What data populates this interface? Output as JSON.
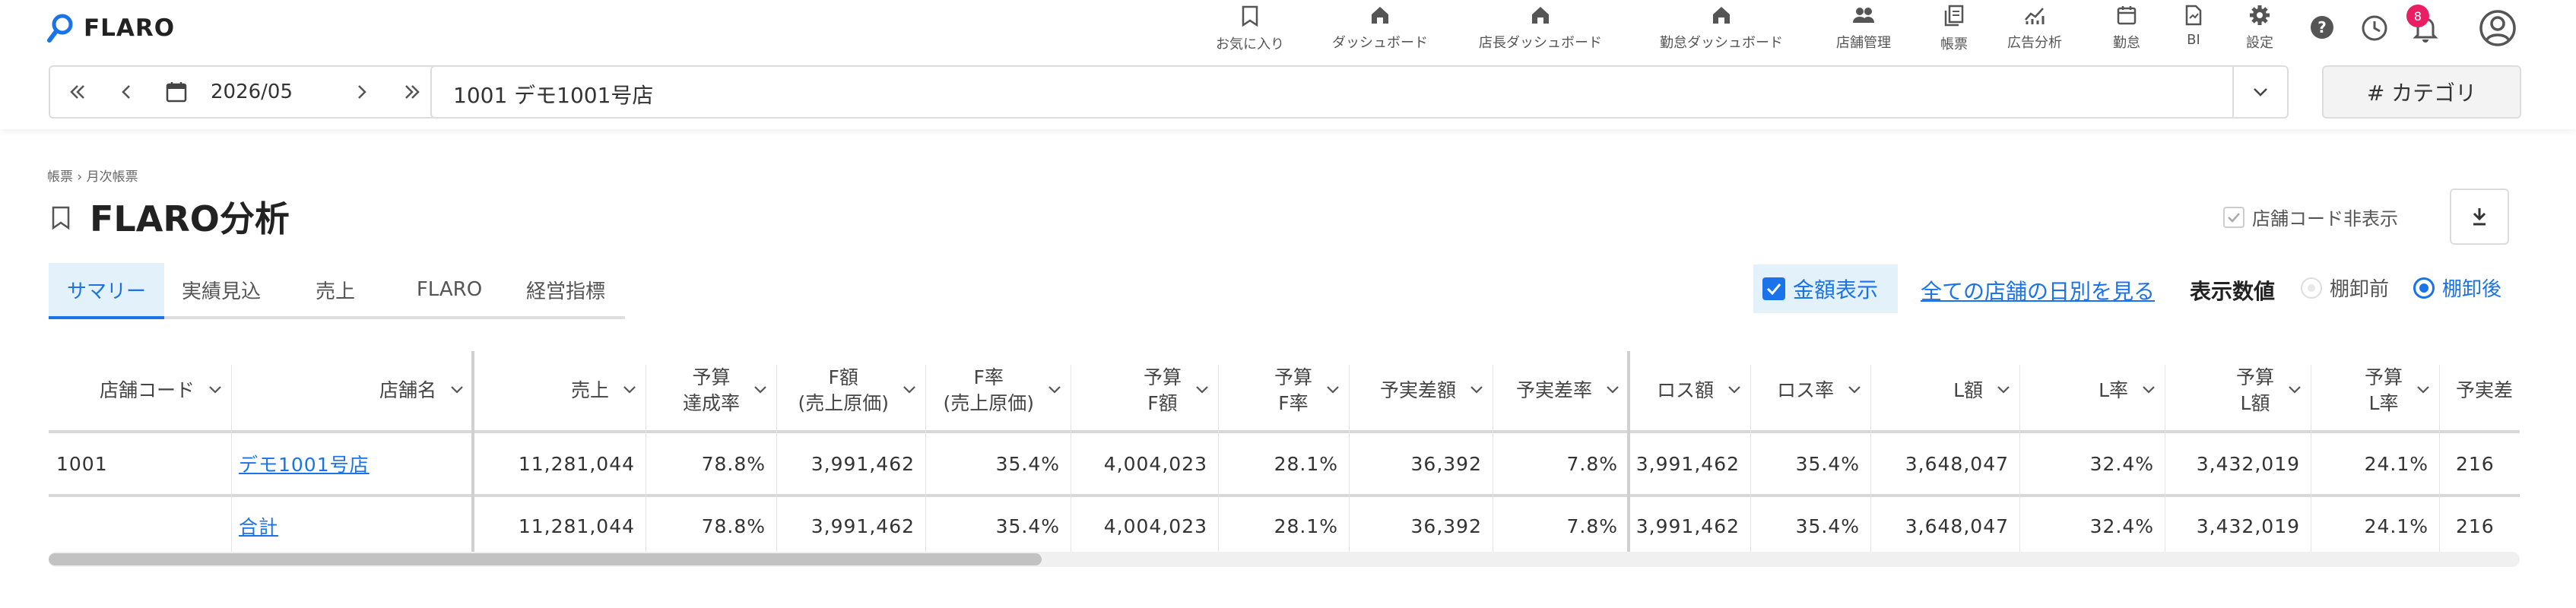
{
  "app": {
    "logo_text": "FLARO",
    "brand_color": "#1a73e8"
  },
  "nav": [
    {
      "label": "お気に入り",
      "icon": "bookmark-icon"
    },
    {
      "label": "ダッシュボード",
      "icon": "home-icon"
    },
    {
      "label": "店長ダッシュボード",
      "icon": "home-icon"
    },
    {
      "label": "勤怠ダッシュボード",
      "icon": "home-icon"
    },
    {
      "label": "店舗管理",
      "icon": "people-icon"
    },
    {
      "label": "帳票",
      "icon": "report-icon"
    },
    {
      "label": "広告分析",
      "icon": "analytics-icon"
    },
    {
      "label": "勤怠",
      "icon": "calendar-icon"
    },
    {
      "label": "BI",
      "icon": "document-icon"
    },
    {
      "label": "設定",
      "icon": "gear-icon"
    }
  ],
  "notifications": {
    "count": "8"
  },
  "date_nav": {
    "date": "2026/05"
  },
  "store_select": {
    "value": "1001 デモ1001号店"
  },
  "category_button": {
    "label": "# カテゴリ"
  },
  "breadcrumb": {
    "text": "帳票 › 月次帳票"
  },
  "page": {
    "title": "FLARO分析"
  },
  "hide_store_code": {
    "label": "店舗コード非表示"
  },
  "tabs": [
    "サマリー",
    "実績見込",
    "売上",
    "FLARO",
    "経営指標"
  ],
  "controls": {
    "amount_display": "金額表示",
    "all_stores_link": "全ての店舗の日別を見る",
    "display_values_label": "表示数値",
    "radio_before": "棚卸前",
    "radio_after": "棚卸後"
  },
  "table": {
    "headers": [
      "店舗コード",
      "店舗名",
      "売上",
      "予算\n達成率",
      "F額\n(売上原価)",
      "F率\n(売上原価)",
      "予算\nF額",
      "予算\nF率",
      "予実差額",
      "予実差率",
      "ロス額",
      "ロス率",
      "L額",
      "L率",
      "予算\nL額",
      "予算\nL率",
      "予実差"
    ],
    "rows": [
      [
        "1001",
        "デモ1001号店",
        "11,281,044",
        "78.8%",
        "3,991,462",
        "35.4%",
        "4,004,023",
        "28.1%",
        "36,392",
        "7.8%",
        "3,991,462",
        "35.4%",
        "3,648,047",
        "32.4%",
        "3,432,019",
        "24.1%",
        "216"
      ],
      [
        "",
        "合計",
        "11,281,044",
        "78.8%",
        "3,991,462",
        "35.4%",
        "4,004,023",
        "28.1%",
        "36,392",
        "7.8%",
        "3,991,462",
        "35.4%",
        "3,648,047",
        "32.4%",
        "3,432,019",
        "24.1%",
        "216"
      ]
    ]
  }
}
